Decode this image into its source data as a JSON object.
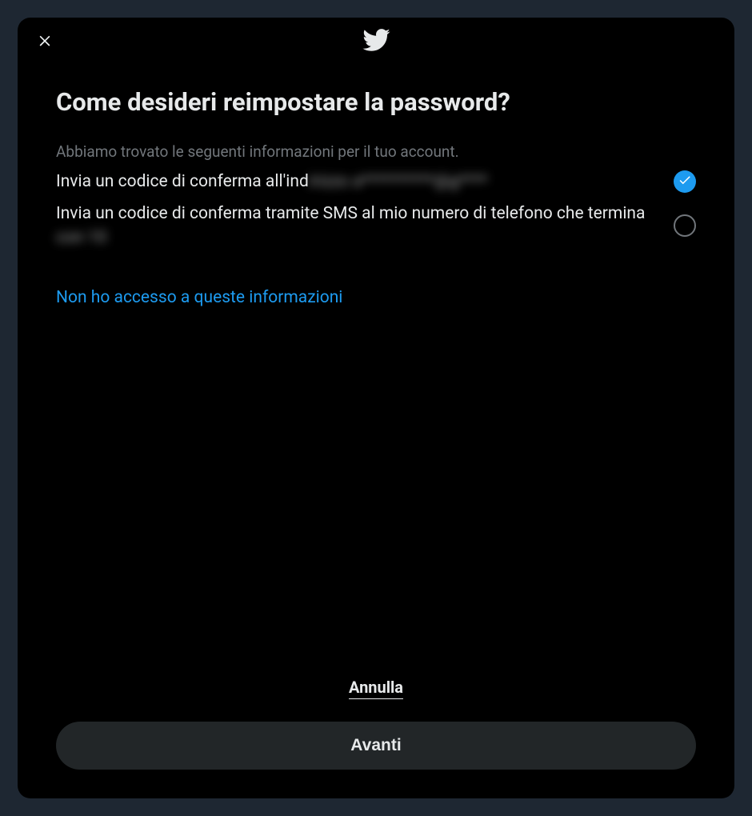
{
  "header": {
    "close_aria": "Chiudi"
  },
  "title": "Come desideri reimpostare la password?",
  "subtitle": "Abbiamo trovato le seguenti informazioni per il tuo account.",
  "options": {
    "email": {
      "prefix": "Invia un codice di conferma all'ind",
      "blurred": "irizzo a**********@g****",
      "selected": true
    },
    "sms": {
      "prefix": "Invia un codice di conferma tramite SMS al mio numero di telefono che termina ",
      "blurred": "con 10",
      "selected": false
    }
  },
  "no_access_link": "Non ho accesso a queste informazioni",
  "footer": {
    "cancel": "Annulla",
    "next": "Avanti"
  }
}
